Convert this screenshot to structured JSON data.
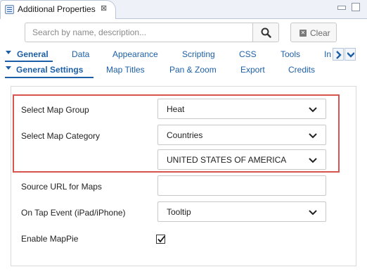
{
  "window": {
    "tab_title": "Additional Properties",
    "tab_close": "⊠"
  },
  "search": {
    "placeholder": "Search by name, description...",
    "value": "",
    "clear_label": "Clear"
  },
  "tabs_primary": [
    {
      "label": "General",
      "active": true
    },
    {
      "label": "Data"
    },
    {
      "label": "Appearance"
    },
    {
      "label": "Scripting"
    },
    {
      "label": "CSS"
    },
    {
      "label": "Tools"
    },
    {
      "label": "In"
    }
  ],
  "tabs_secondary": [
    {
      "label": "General Settings",
      "active": true
    },
    {
      "label": "Map Titles"
    },
    {
      "label": "Pan & Zoom"
    },
    {
      "label": "Export"
    },
    {
      "label": "Credits"
    }
  ],
  "properties": {
    "map_group": {
      "label": "Select Map Group",
      "value": "Heat"
    },
    "map_category": {
      "label": "Select Map Category",
      "value": "Countries",
      "sub_value": "UNITED STATES OF AMERICA"
    },
    "source_url": {
      "label": "Source URL for Maps",
      "value": ""
    },
    "on_tap": {
      "label": "On Tap Event (iPad/iPhone)",
      "value": "Tooltip"
    },
    "mappie": {
      "label": "Enable MapPie",
      "checked": true
    }
  },
  "colors": {
    "accent": "#1d5fa6",
    "highlight": "#d9534f"
  }
}
